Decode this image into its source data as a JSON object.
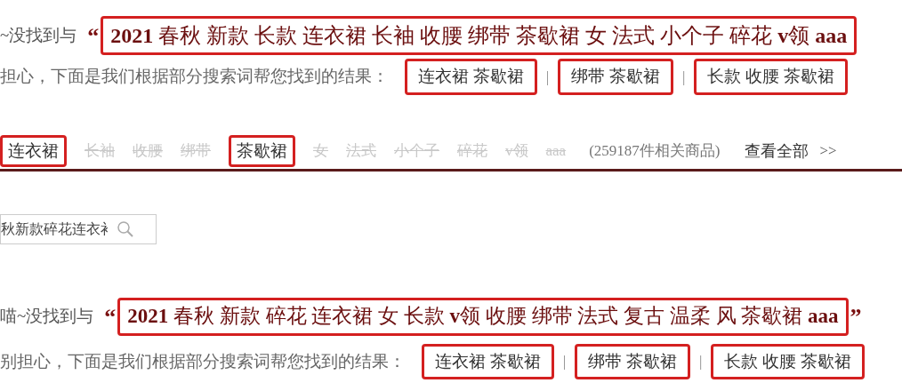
{
  "notice_top": {
    "prefix": "~没找到与",
    "open_quote": "“",
    "query": "**2021** 春秋 新款 长款 连衣裙 长袖 收腰 绑带 茶歇裙 女 法式 小个子 碎花 **v**领 **aaa**",
    "hint": "担心，下面是我们根据部分搜索词帮您找到的结果：",
    "suggestions": [
      {
        "label": "连衣裙 茶歇裙"
      },
      {
        "label": "绑带 茶歇裙"
      },
      {
        "label": "长款 收腰 茶歇裙"
      }
    ],
    "separators": [
      "|",
      "|"
    ]
  },
  "token_bar": {
    "tokens": [
      {
        "label": "连衣裙",
        "matched": true
      },
      {
        "label": "长袖",
        "matched": false
      },
      {
        "label": "收腰",
        "matched": false
      },
      {
        "label": "绑带",
        "matched": false
      },
      {
        "label": "茶歇裙",
        "matched": true
      },
      {
        "label": "女",
        "matched": false
      },
      {
        "label": "法式",
        "matched": false
      },
      {
        "label": "小个子",
        "matched": false
      },
      {
        "label": "碎花",
        "matched": false
      },
      {
        "label": "v领",
        "matched": false
      },
      {
        "label": "aaa",
        "matched": false
      }
    ],
    "count": "(259187件相关商品)",
    "view_all": "查看全部",
    "chevrons": ">>"
  },
  "search": {
    "value": "秋新款碎花连衣衤"
  },
  "notice_bottom": {
    "prefix": "喵~没找到与",
    "open_quote": "“",
    "query": "**2021** 春秋 新款 碎花 连衣裙 女 长款 **v**领 收腰 绑带 法式 复古 温柔 风 茶歇裙 **aaa**",
    "close_quote": "”",
    "hint": "别担心，下面是我们根据部分搜索词帮您找到的结果：",
    "suggestions": [
      {
        "label": "连衣裙 茶歇裙"
      },
      {
        "label": "绑带 茶歇裙"
      },
      {
        "label": "长款 收腰 茶歇裙"
      }
    ],
    "separators": [
      "|",
      "|"
    ]
  }
}
